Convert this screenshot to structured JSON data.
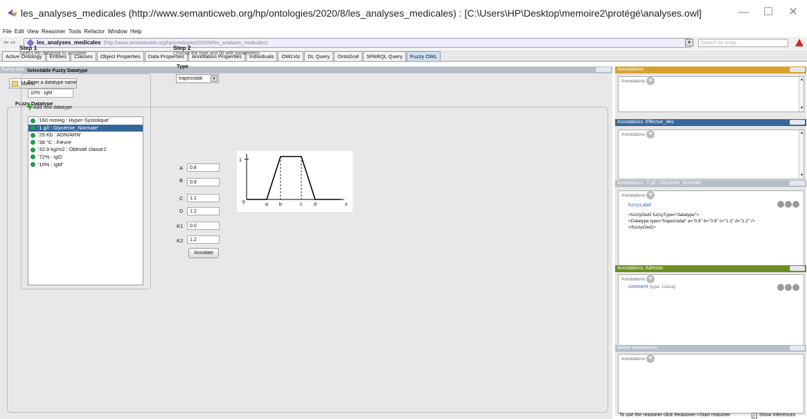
{
  "window": {
    "title": "les_analyses_medicales (http://www.semanticweb.org/hp/ontologies/2020/8/les_analyses_medicales) : [C:\\Users\\HP\\Desktop\\memoire2\\protégé\\analyses.owl]",
    "minimize": "—",
    "maximize": "☐",
    "close": "✕"
  },
  "menubar": [
    "File",
    "Edit",
    "View",
    "Reasoner",
    "Tools",
    "Refactor",
    "Window",
    "Help"
  ],
  "address": {
    "nav": "⇦ ⇨",
    "ontology_name": "les_analyses_medicales",
    "ontology_url": "(http://www.semanticweb.org/hp/ontologies/2020/8/les_analyses_medicales)",
    "search_placeholder": "Search for entity"
  },
  "tabs": [
    {
      "label": "Active Ontology"
    },
    {
      "label": "Entities"
    },
    {
      "label": "Classes"
    },
    {
      "label": "Object Properties"
    },
    {
      "label": "Data Properties"
    },
    {
      "label": "Annotation Properties"
    },
    {
      "label": "Individuals"
    },
    {
      "label": "OWLViz"
    },
    {
      "label": "DL Query"
    },
    {
      "label": "OntoGraf"
    },
    {
      "label": "SPARQL Query"
    },
    {
      "label": "Fuzzy OWL",
      "active": true
    }
  ],
  "fuzzy": {
    "panel_title": "Fuzzy Owl",
    "menu_label": "Menu",
    "section_title": "Fuzzy Datatype",
    "step1_title": "Step 1",
    "step1_sub": "Select the datatype to annotate",
    "step2_title": "Step 2",
    "step2_sub": "Choose the type and fill with parameters",
    "selectable_title": "Selectable Fuzzy Datatype",
    "enter_label": "Enter a datatype name",
    "name_value": "10% : igM",
    "add_label": "Add new datatype",
    "datatypes": [
      "'160 mmHg : Hyper-Systolique'",
      "'1 g/l : Glycémie_Normale'",
      "'29 Kb : ADN/ARN'",
      "'38 °C : Fièvre'",
      "'32.9 kg/m2 : Obésité classe1'",
      "'72% : igG'",
      "'10% : igM'"
    ],
    "selected_index": 1,
    "type_label": "Type",
    "type_value": "trapezoidal",
    "params": {
      "A": {
        "label": "A",
        "value": "0.8"
      },
      "B": {
        "label": "B",
        "value": "0.9"
      },
      "C": {
        "label": "C",
        "value": "1.1"
      },
      "D": {
        "label": "D",
        "value": "1.2"
      },
      "K1": {
        "label": "K1",
        "value": "0.0"
      },
      "K2": {
        "label": "K2",
        "value": "1.2"
      }
    },
    "annotate_label": "Annotate",
    "graph": {
      "y_one": "1",
      "origin": "0",
      "ticks": [
        "a",
        "b",
        "c",
        "d"
      ],
      "x_label": "x"
    }
  },
  "right": {
    "panels": [
      {
        "header": "Annotations:",
        "color": "#d6a22d",
        "label": "Annotations"
      },
      {
        "header": "Annotations: Effectue_des",
        "color": "#35679a",
        "label": "Annotations"
      },
      {
        "header": "Annotations: '1 g/l : Glycémie_Normale'",
        "color": "#b6bec8",
        "label": "Annotations",
        "prop": "fuzzyLabel",
        "lines": [
          "<fuzzyOwl2 fuzzyType=\"datatype\">",
          "<Datatype type=\"trapezoidal\" a=\"0.8\" b=\"0.9\" c=\"1.1\" d=\"1.2\" />",
          "</fuzzyOwl2>"
        ]
      },
      {
        "header": "Annotations: Adresse",
        "color": "#6b8e23",
        "label": "Annotations",
        "prop": "comment",
        "prop_type": "[type: Literal]"
      },
      {
        "header": "Axiom annotations",
        "color": "#b6bec8",
        "label": "Annotations"
      }
    ]
  },
  "status": {
    "text": "To use the reasoner click Reasoner->Start reasoner",
    "show_inferences": "Show Inferences",
    "check": "✓"
  }
}
